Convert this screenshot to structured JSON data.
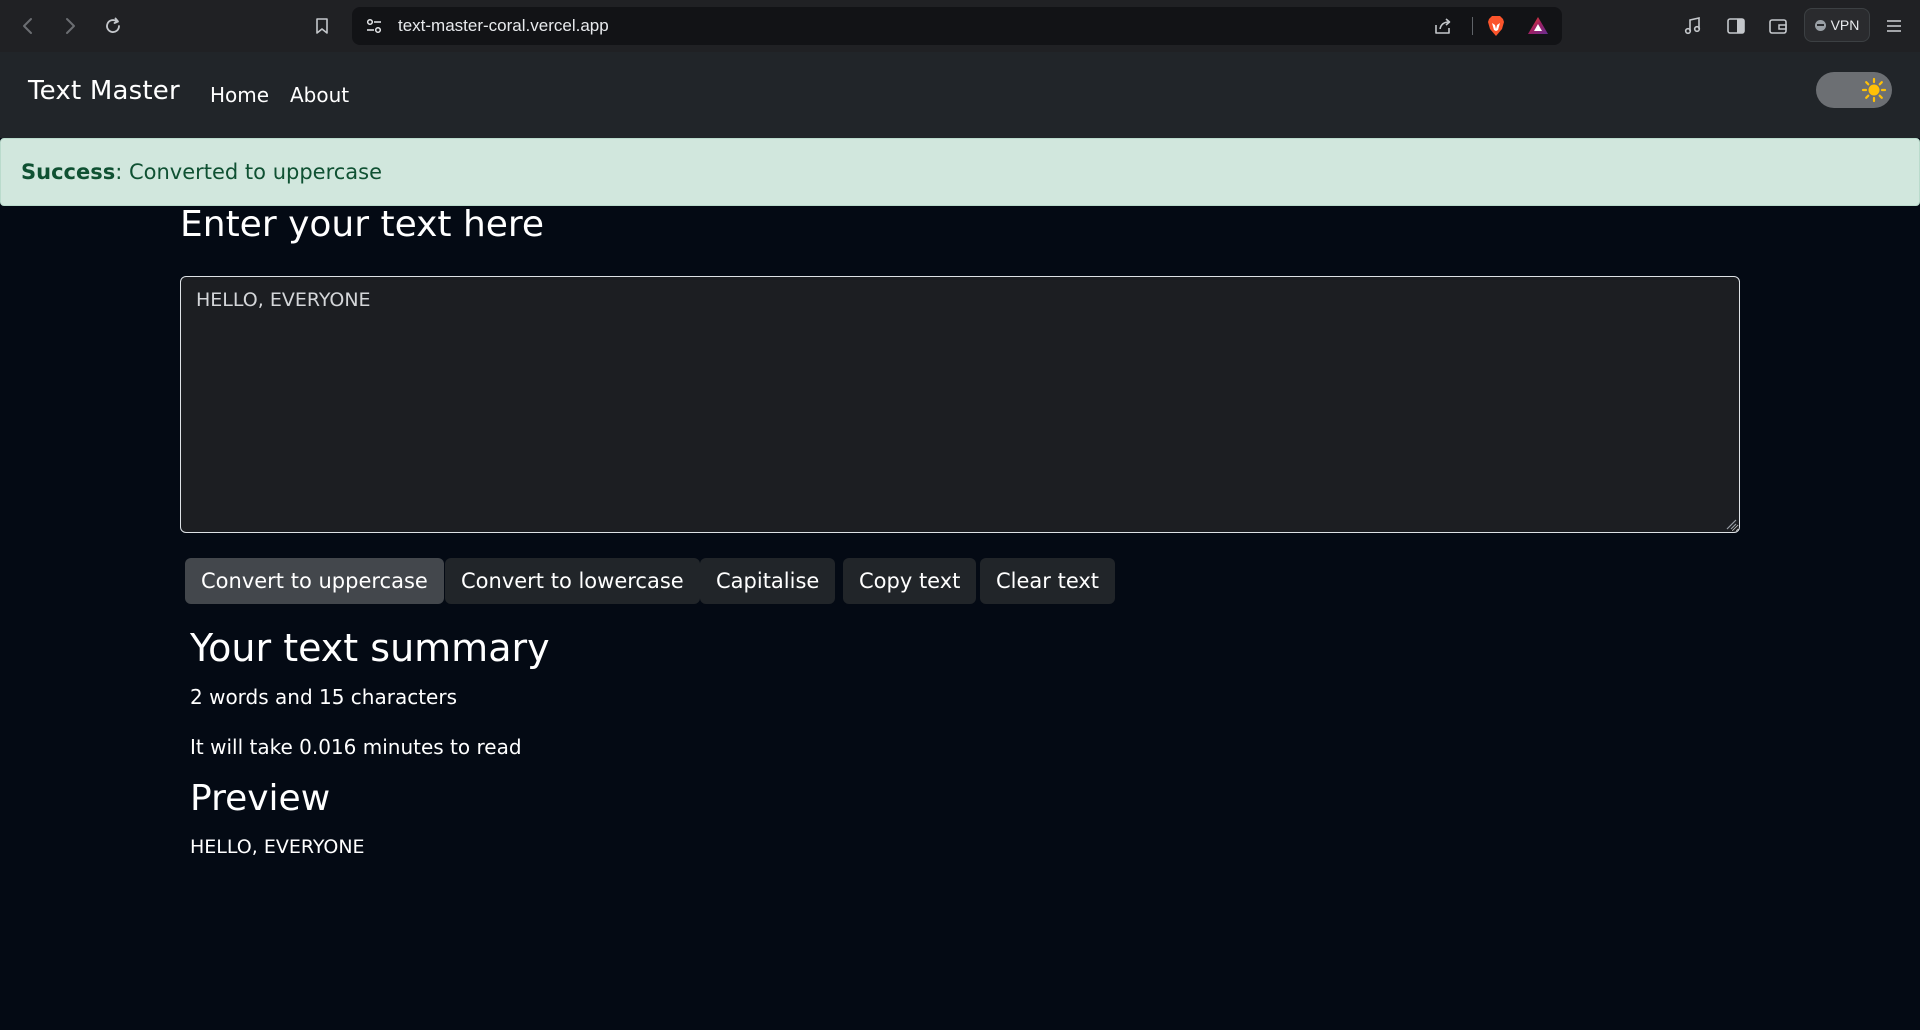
{
  "browser": {
    "url": "text-master-coral.vercel.app",
    "vpn_label": "VPN"
  },
  "navbar": {
    "brand": "Text Master",
    "links": [
      "Home",
      "About"
    ]
  },
  "alert": {
    "type_label": "Success",
    "message": ": Converted to uppercase"
  },
  "main": {
    "heading": "Enter your text here",
    "textarea_value": "HELLO, EVERYONE",
    "buttons": [
      "Convert to uppercase",
      "Convert to lowercase",
      "Capitalise",
      "Copy text",
      "Clear text"
    ],
    "summary_title": "Your text summary",
    "word_char_count": "2 words and 15 characters",
    "read_time": "It will take 0.016 minutes to read",
    "preview_title": "Preview",
    "preview_text": "HELLO, EVERYONE"
  },
  "colors": {
    "page_background": "#040a14",
    "navbar_background": "#212529",
    "alert_background": "#d1e7dd",
    "alert_text": "#0f5132",
    "button_background": "#212529",
    "button_active_background": "#43474c",
    "toggle_knob": "#ffc107"
  },
  "icons": {
    "back": "arrow-left-icon",
    "forward": "arrow-right-icon",
    "reload": "reload-icon",
    "bookmark": "bookmark-icon",
    "site_settings": "site-settings-icon",
    "share": "share-icon",
    "brave_shields": "brave-lion-icon",
    "brave_rewards": "triangle-rewards-icon",
    "media": "music-note-icon",
    "sidebar": "sidebar-icon",
    "wallet": "wallet-icon",
    "menu": "hamburger-menu-icon",
    "theme": "sun-icon"
  }
}
